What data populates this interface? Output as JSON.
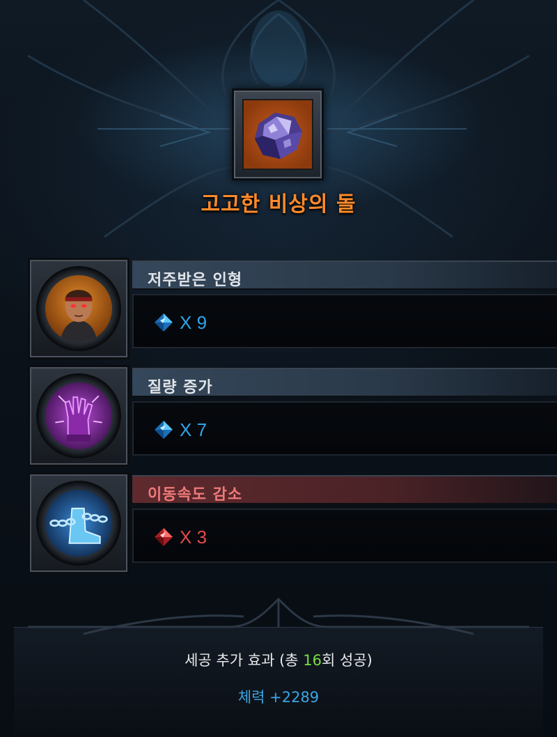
{
  "item": {
    "name": "고고한 비상의 돌",
    "icon": "purple-crystal-stone-icon",
    "frame_bg_color": "#c45a1c",
    "name_color": "#ff8a2a"
  },
  "effects": [
    {
      "name": "저주받은 인형",
      "type": "buff",
      "icon": "cursed-doll-portrait-icon",
      "gem": "blue-gem-icon",
      "count_label": "X 9",
      "count": 9
    },
    {
      "name": "질량 증가",
      "type": "buff",
      "icon": "purple-gauntlet-icon",
      "gem": "blue-gem-icon",
      "count_label": "X 7",
      "count": 7
    },
    {
      "name": "이동속도 감소",
      "type": "debuff",
      "icon": "chained-boot-icon",
      "gem": "red-gem-icon",
      "count_label": "X 3",
      "count": 3
    }
  ],
  "bonus": {
    "prefix": "세공 추가 효과 (총 ",
    "success_count": "16",
    "suffix": "회 성공)",
    "stat": "체력 +2289",
    "highlight_color": "#7ddc3c",
    "stat_color": "#3aa6e6"
  },
  "colors": {
    "buff_count": "#2ea6e8",
    "debuff_count": "#e64a4a",
    "debuff_name": "#f07a7a"
  }
}
